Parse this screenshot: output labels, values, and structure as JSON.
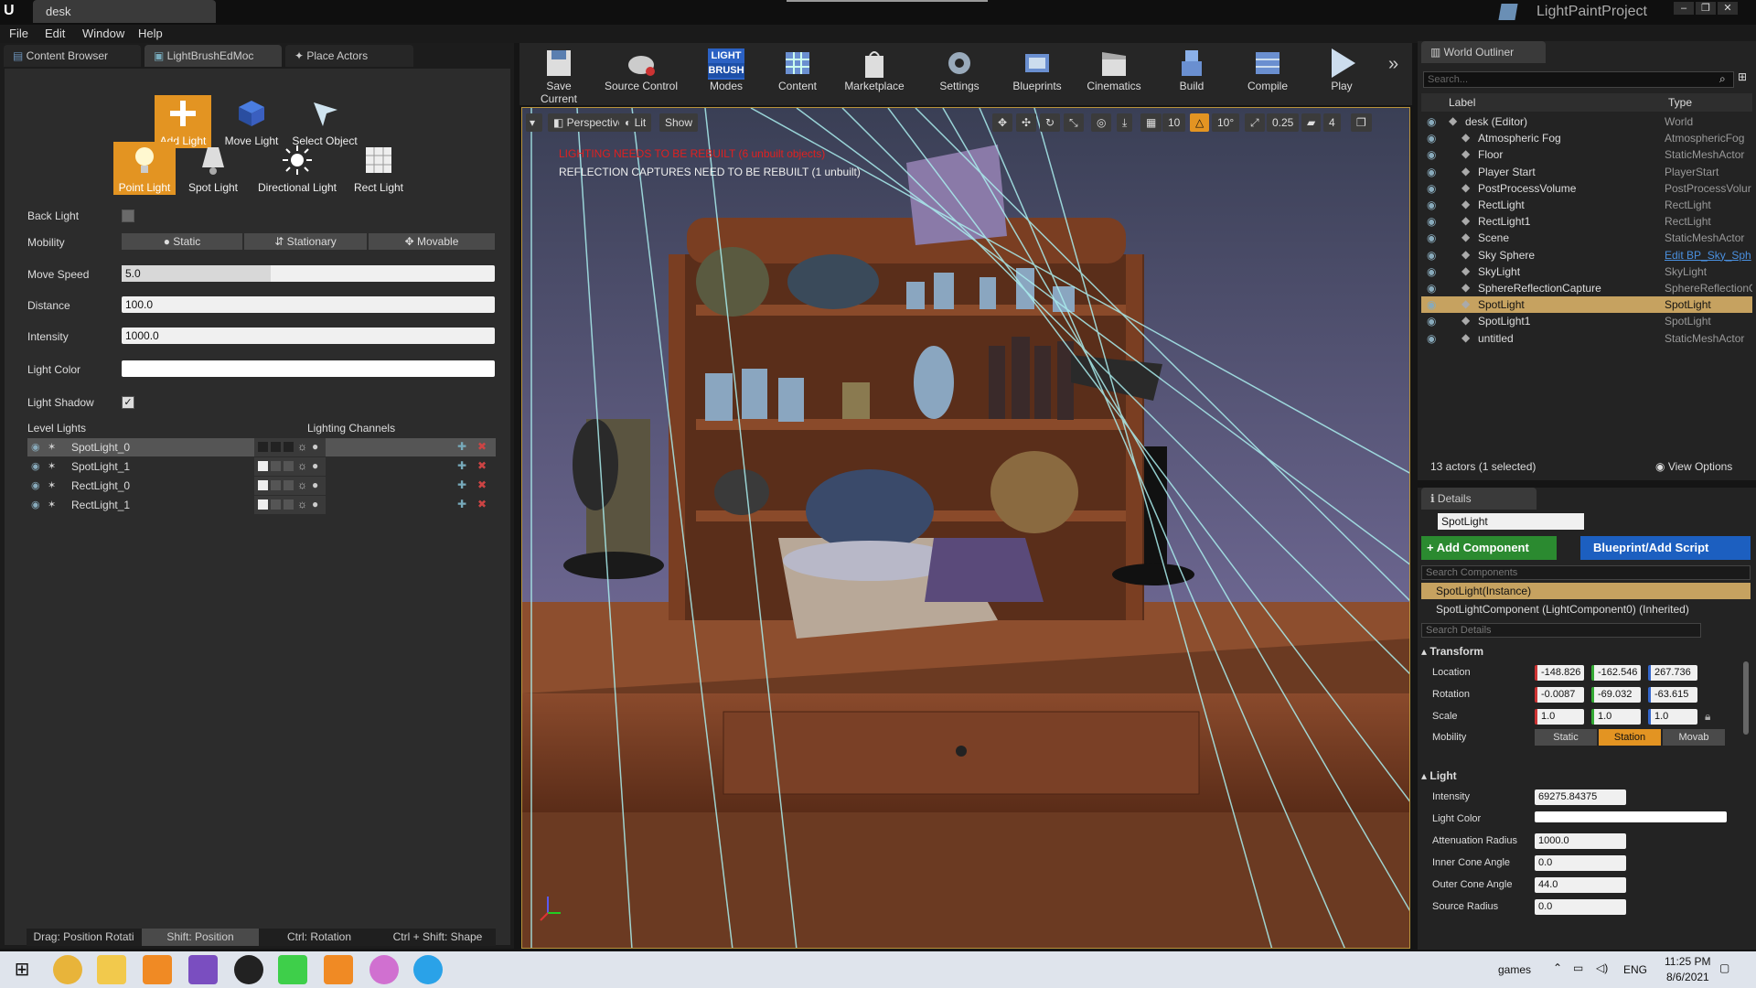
{
  "window": {
    "tab_title": "desk",
    "project_name": "LightPaintProject",
    "min": "–",
    "max": "❐",
    "close": "✕"
  },
  "menu": [
    "File",
    "Edit",
    "Window",
    "Help"
  ],
  "panel_tabs": {
    "content_browser": "Content Browser",
    "light_brush": "LightBrushEdMoc",
    "place_actors": "Place Actors"
  },
  "light_brush": {
    "tools_row1": {
      "add_light": "Add Light",
      "move_light": "Move Light",
      "select_object": "Select Object"
    },
    "tools_row2": {
      "point_light": "Point Light",
      "spot_light": "Spot Light",
      "directional_light": "Directional Light",
      "rect_light": "Rect Light"
    },
    "back_light_label": "Back Light",
    "mobility_label": "Mobility",
    "mobility_options": {
      "static": "Static",
      "stationary": "Stationary",
      "movable": "Movable"
    },
    "move_speed_label": "Move Speed",
    "move_speed": "5.0",
    "move_speed_fraction": 0.4,
    "distance_label": "Distance",
    "distance": "100.0",
    "intensity_label": "Intensity",
    "intensity": "1000.0",
    "light_color_label": "Light Color",
    "light_shadow_label": "Light Shadow",
    "level_lights_header": "Level Lights",
    "lighting_channels_header": "Lighting Channels",
    "lights": [
      "SpotLight_0",
      "SpotLight_1",
      "RectLight_0",
      "RectLight_1"
    ],
    "hints": {
      "drag": "Drag: Position Rotati",
      "shift": "Shift: Position",
      "ctrl": "Ctrl: Rotation",
      "ctrl_shift": "Ctrl + Shift: Shape"
    }
  },
  "toolbar": {
    "save_current": "Save Current",
    "source_control": "Source Control",
    "modes": "Modes",
    "modes_badge_top": "LIGHT",
    "modes_badge_bottom": "BRUSH",
    "content": "Content",
    "marketplace": "Marketplace",
    "settings": "Settings",
    "blueprints": "Blueprints",
    "cinematics": "Cinematics",
    "build": "Build",
    "compile": "Compile",
    "play": "Play"
  },
  "viewport": {
    "perspective": "Perspective",
    "lit": "Lit",
    "show": "Show",
    "warning_lighting": "LIGHTING NEEDS TO BE REBUILT (6 unbuilt objects)",
    "warning_reflection": "REFLECTION CAPTURES NEED TO BE REBUILT (1 unbuilt)",
    "grid": "10",
    "angle": "10°",
    "scale": "0.25",
    "cam_speed": "4"
  },
  "outliner": {
    "tab": "World Outliner",
    "search_placeholder": "Search...",
    "col_label": "Label",
    "col_type": "Type",
    "rows": [
      {
        "label": "desk (Editor)",
        "type": "World"
      },
      {
        "label": "Atmospheric Fog",
        "type": "AtmosphericFog"
      },
      {
        "label": "Floor",
        "type": "StaticMeshActor"
      },
      {
        "label": "Player Start",
        "type": "PlayerStart"
      },
      {
        "label": "PostProcessVolume",
        "type": "PostProcessVolur"
      },
      {
        "label": "RectLight",
        "type": "RectLight"
      },
      {
        "label": "RectLight1",
        "type": "RectLight"
      },
      {
        "label": "Scene",
        "type": "StaticMeshActor"
      },
      {
        "label": "Sky Sphere",
        "type": "Edit BP_Sky_Sph"
      },
      {
        "label": "SkyLight",
        "type": "SkyLight"
      },
      {
        "label": "SphereReflectionCapture",
        "type": "SphereReflectionC"
      },
      {
        "label": "SpotLight",
        "type": "SpotLight"
      },
      {
        "label": "SpotLight1",
        "type": "SpotLight"
      },
      {
        "label": "untitled",
        "type": "StaticMeshActor"
      }
    ],
    "status": "13 actors (1 selected)",
    "view_options": "View Options"
  },
  "details": {
    "tab": "Details",
    "name": "SpotLight",
    "add_component": "+ Add Component",
    "blueprint": "Blueprint/Add Script",
    "search_components": "Search Components",
    "instance": "SpotLight(Instance)",
    "component": "SpotLightComponent (LightComponent0) (Inherited)",
    "search_details": "Search Details",
    "transform_header": "Transform",
    "location_label": "Location",
    "location": [
      "-148.826",
      "-162.546",
      "267.736"
    ],
    "rotation_label": "Rotation",
    "rotation": [
      "-0.0087",
      "-69.032",
      "-63.615"
    ],
    "scale_label": "Scale",
    "scale": [
      "1.0",
      "1.0",
      "1.0"
    ],
    "mobility_label": "Mobility",
    "mobility": {
      "static": "Static",
      "stationary": "Station",
      "movable": "Movab"
    },
    "light_header": "Light",
    "intensity_label": "Intensity",
    "intensity": "69275.84375",
    "light_color_label": "Light Color",
    "attenuation_label": "Attenuation Radius",
    "attenuation": "1000.0",
    "inner_cone_label": "Inner Cone Angle",
    "inner_cone": "0.0",
    "outer_cone_label": "Outer Cone Angle",
    "outer_cone": "44.0",
    "source_radius_label": "Source Radius",
    "source_radius": "0.0"
  },
  "taskbar": {
    "user": "games",
    "lang": "ENG",
    "time": "11:25 PM",
    "date": "8/6/2021"
  }
}
